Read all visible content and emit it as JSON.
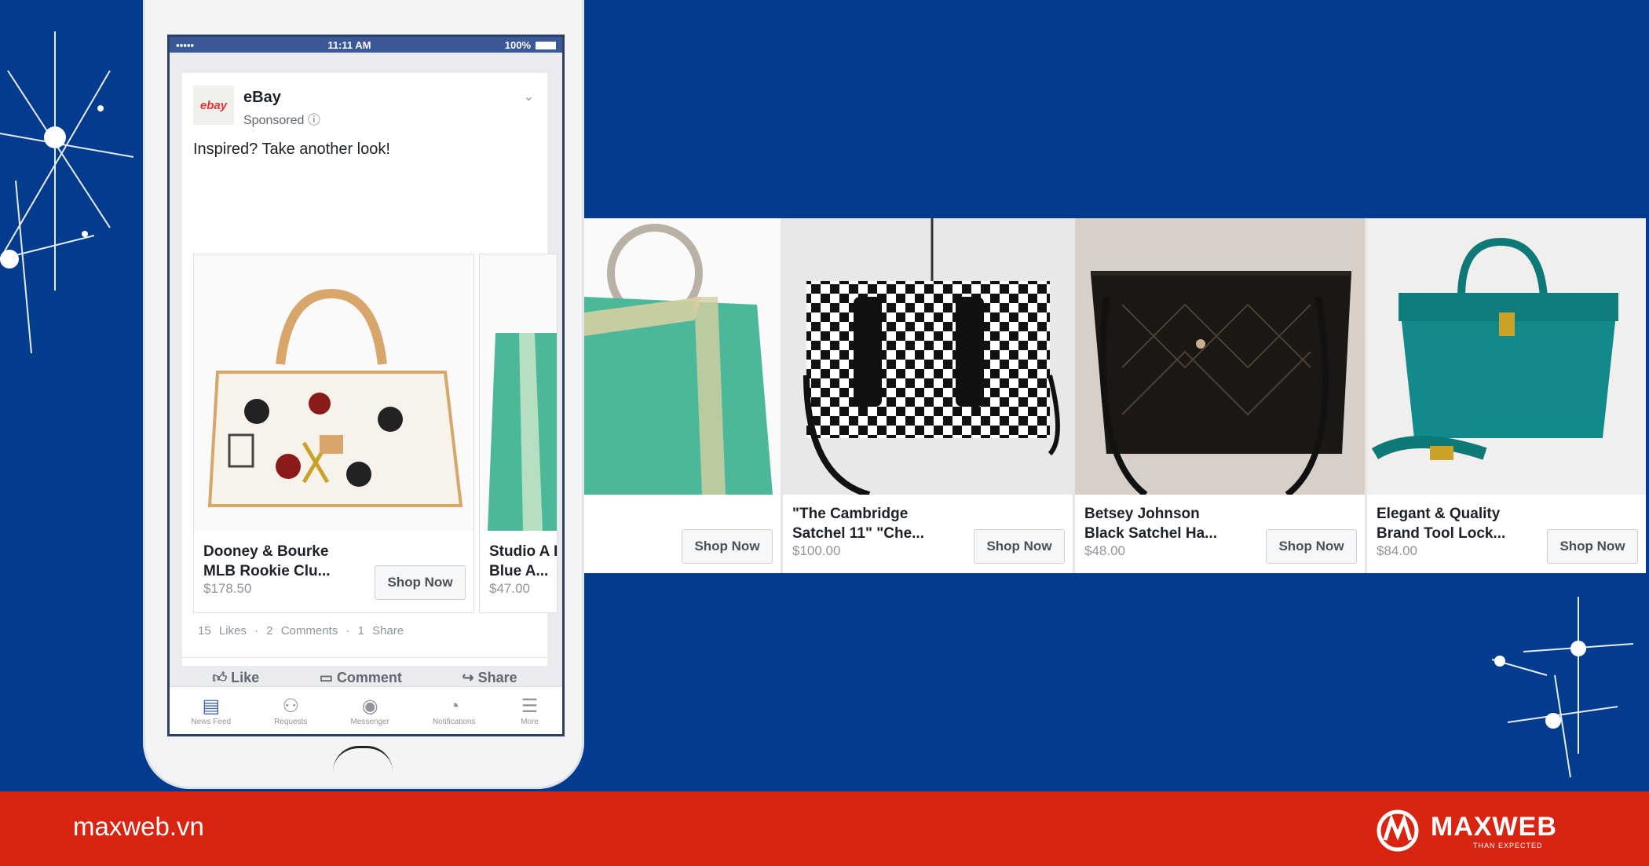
{
  "status_bar": {
    "signal": "▪▪▪▪▪",
    "time": "11:11 AM",
    "battery_text": "100%"
  },
  "post": {
    "logo_text": "ebay",
    "page_name": "eBay",
    "page_sub": "Sponsored ⓘ",
    "menu": "⌄",
    "text": "Inspired? Take another look!"
  },
  "products": [
    {
      "title": "Dooney & Bourke\nMLB Rookie Clu...",
      "price": "$178.50",
      "button": "Shop Now"
    },
    {
      "title": "Studio A Purse\nBlue A...",
      "price": "$47.00",
      "button": "Shop Now"
    },
    {
      "title": "\"The Cambridge\nSatchel 11\" \"Che...",
      "price": "$100.00",
      "button": "Shop Now"
    },
    {
      "title": "Betsey Johnson\nBlack Satchel Ha...",
      "price": "$48.00",
      "button": "Shop Now"
    },
    {
      "title": "Elegant & Quality\nBrand Tool Lock...",
      "price": "$84.00",
      "button": "Shop Now"
    }
  ],
  "reactions": "15 Likes · 2 Comments · 1 Share",
  "actions": {
    "like": "Like",
    "comment": "Comment",
    "share": "Share"
  },
  "tabbar": [
    "News Feed",
    "Requests",
    "Messenger",
    "Notifications",
    "More"
  ],
  "footer": {
    "site": "maxweb.vn",
    "brand": "MAXWEB",
    "tagline": "THAN EXPECTED"
  },
  "colors": {
    "background": "#033c8f",
    "footer": "#d92411",
    "facebook_blue": "#3b5998"
  }
}
